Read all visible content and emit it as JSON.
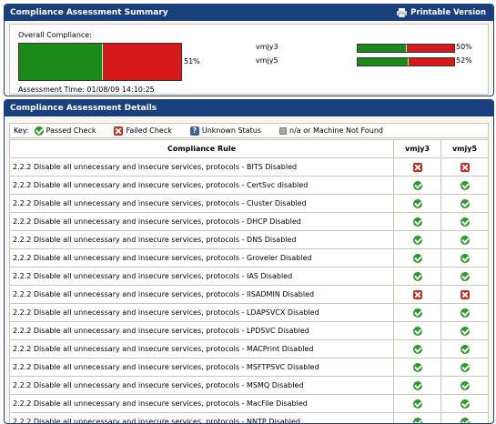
{
  "summary": {
    "title": "Compliance Assessment Summary",
    "printable": "Printable Version",
    "overall_label": "Overall Compliance:",
    "overall_pct": "51%",
    "overall_fraction": 0.51,
    "assessment_time": "Assessment Time: 01/08/09 14:10:25",
    "machines": [
      {
        "name": "vmjy3",
        "pct": "50%",
        "fraction": 0.5
      },
      {
        "name": "vmjy5",
        "pct": "52%",
        "fraction": 0.52
      }
    ]
  },
  "details": {
    "title": "Compliance Assessment Details",
    "key": {
      "label": "Key:",
      "passed": "Passed Check",
      "failed": "Failed Check",
      "unknown": "Unknown Status",
      "na": "n/a or Machine Not Found"
    },
    "columns": [
      "Compliance Rule",
      "vmjy3",
      "vmjy5"
    ],
    "rows": [
      {
        "rule": "2.2.2 Disable all unnecessary and insecure services, protocols - BITS Disabled",
        "s": [
          "failed",
          "failed"
        ]
      },
      {
        "rule": "2.2.2 Disable all unnecessary and insecure services, protocols - CertSvc disabled",
        "s": [
          "passed",
          "passed"
        ]
      },
      {
        "rule": "2.2.2 Disable all unnecessary and insecure services, protocols - Cluster Disabled",
        "s": [
          "passed",
          "passed"
        ]
      },
      {
        "rule": "2.2.2 Disable all unnecessary and insecure services, protocols - DHCP Disabled",
        "s": [
          "passed",
          "passed"
        ]
      },
      {
        "rule": "2.2.2 Disable all unnecessary and insecure services, protocols - DNS Disabled",
        "s": [
          "passed",
          "passed"
        ]
      },
      {
        "rule": "2.2.2 Disable all unnecessary and insecure services, protocols - Groveler Disabled",
        "s": [
          "passed",
          "passed"
        ]
      },
      {
        "rule": "2.2.2 Disable all unnecessary and insecure services, protocols - IAS Disabled",
        "s": [
          "passed",
          "passed"
        ]
      },
      {
        "rule": "2.2.2 Disable all unnecessary and insecure services, protocols - IISADMIN Disabled",
        "s": [
          "failed",
          "failed"
        ]
      },
      {
        "rule": "2.2.2 Disable all unnecessary and insecure services, protocols - LDAPSVCX Disabled",
        "s": [
          "passed",
          "passed"
        ]
      },
      {
        "rule": "2.2.2 Disable all unnecessary and insecure services, protocols - LPDSVC Disabled",
        "s": [
          "passed",
          "passed"
        ]
      },
      {
        "rule": "2.2.2 Disable all unnecessary and insecure services, protocols - MACPrint Disabled",
        "s": [
          "passed",
          "passed"
        ]
      },
      {
        "rule": "2.2.2 Disable all unnecessary and insecure services, protocols - MSFTPSVC Disabled",
        "s": [
          "passed",
          "passed"
        ]
      },
      {
        "rule": "2.2.2 Disable all unnecessary and insecure services, protocols - MSMQ Disabled",
        "s": [
          "passed",
          "passed"
        ]
      },
      {
        "rule": "2.2.2 Disable all unnecessary and insecure services, protocols - MacFile Disabled",
        "s": [
          "passed",
          "passed"
        ]
      },
      {
        "rule": "2.2.2 Disable all unnecessary and insecure services, protocols - NNTP Disabled",
        "s": [
          "passed",
          "passed"
        ]
      }
    ]
  },
  "colors": {
    "header": "#1a3f7f",
    "pass": "#1a8a1a",
    "fail": "#d61a1a"
  }
}
